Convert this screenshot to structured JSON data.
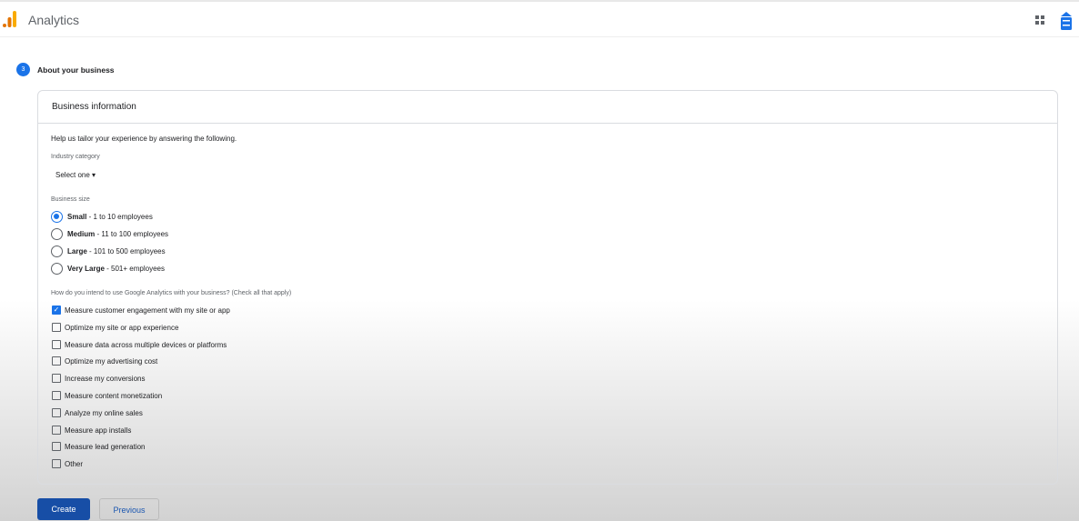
{
  "header": {
    "title": "Analytics",
    "icons": [
      "analytics-logo",
      "apps-grid-icon",
      "account-icon"
    ]
  },
  "step": {
    "number": "3",
    "label": "About your business"
  },
  "card": {
    "title": "Business information",
    "intro": "Help us tailor your experience by answering the following.",
    "industry": {
      "label": "Industry category",
      "value": "Select one"
    },
    "size": {
      "label": "Business size",
      "options": [
        {
          "bold": "Small",
          "rest": " - 1 to 10 employees",
          "selected": true
        },
        {
          "bold": "Medium",
          "rest": " - 11 to 100 employees",
          "selected": false
        },
        {
          "bold": "Large",
          "rest": " - 101 to 500 employees",
          "selected": false
        },
        {
          "bold": "Very Large",
          "rest": " - 501+ employees",
          "selected": false
        }
      ]
    },
    "usage": {
      "label": "How do you intend to use Google Analytics with your business? (Check all that apply)",
      "options": [
        {
          "label": "Measure customer engagement with my site or app",
          "checked": true
        },
        {
          "label": "Optimize my site or app experience",
          "checked": false
        },
        {
          "label": "Measure data across multiple devices or platforms",
          "checked": false
        },
        {
          "label": "Optimize my advertising cost",
          "checked": false
        },
        {
          "label": "Increase my conversions",
          "checked": false
        },
        {
          "label": "Measure content monetization",
          "checked": false
        },
        {
          "label": "Analyze my online sales",
          "checked": false
        },
        {
          "label": "Measure app installs",
          "checked": false
        },
        {
          "label": "Measure lead generation",
          "checked": false
        },
        {
          "label": "Other",
          "checked": false
        }
      ]
    }
  },
  "buttons": {
    "create": "Create",
    "previous": "Previous"
  },
  "colors": {
    "accent": "#1a73e8",
    "create": "#174ea6"
  }
}
